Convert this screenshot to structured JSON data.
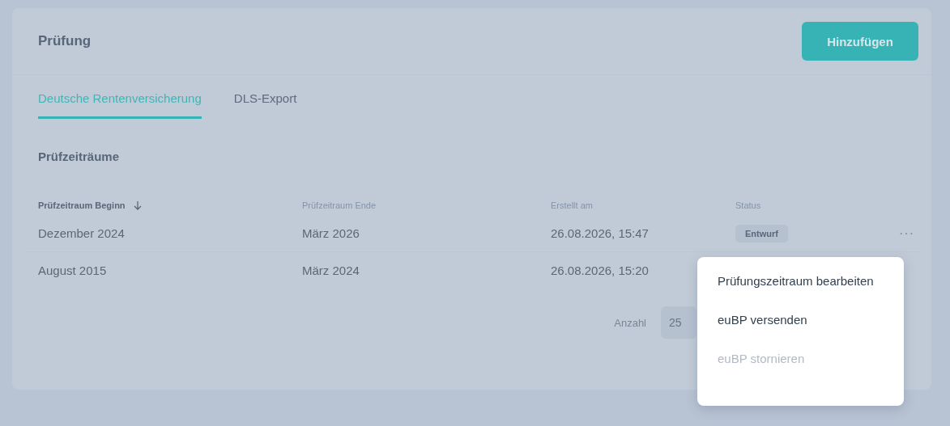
{
  "header": {
    "title": "Prüfung",
    "add_button": "Hinzufügen"
  },
  "tabs": [
    {
      "label": "Deutsche Rentenversicherung",
      "selected": true
    },
    {
      "label": "DLS-Export",
      "selected": false
    }
  ],
  "section_title": "Prüfzeiträume",
  "table": {
    "columns": [
      {
        "label": "Prüfzeitraum Beginn",
        "sorted": true
      },
      {
        "label": "Prüfzeitraum Ende",
        "sorted": false
      },
      {
        "label": "Erstellt am",
        "sorted": false
      },
      {
        "label": "Status",
        "sorted": false
      }
    ],
    "rows": [
      {
        "cells": [
          "Dezember 2024",
          "März 2026",
          "26.08.2026, 15:47"
        ],
        "status": "Entwurf",
        "more": "···"
      },
      {
        "cells": [
          "August 2015",
          "März 2024",
          "26.08.2026, 15:20"
        ]
      }
    ]
  },
  "pagination": {
    "label": "Anzahl",
    "page_size": "25"
  },
  "menu": {
    "items": [
      {
        "label": "Prüfungszeitraum bearbeiten",
        "disabled": false
      },
      {
        "label": "euBP versenden",
        "disabled": false
      },
      {
        "label": "euBP stornieren",
        "disabled": true
      }
    ]
  }
}
